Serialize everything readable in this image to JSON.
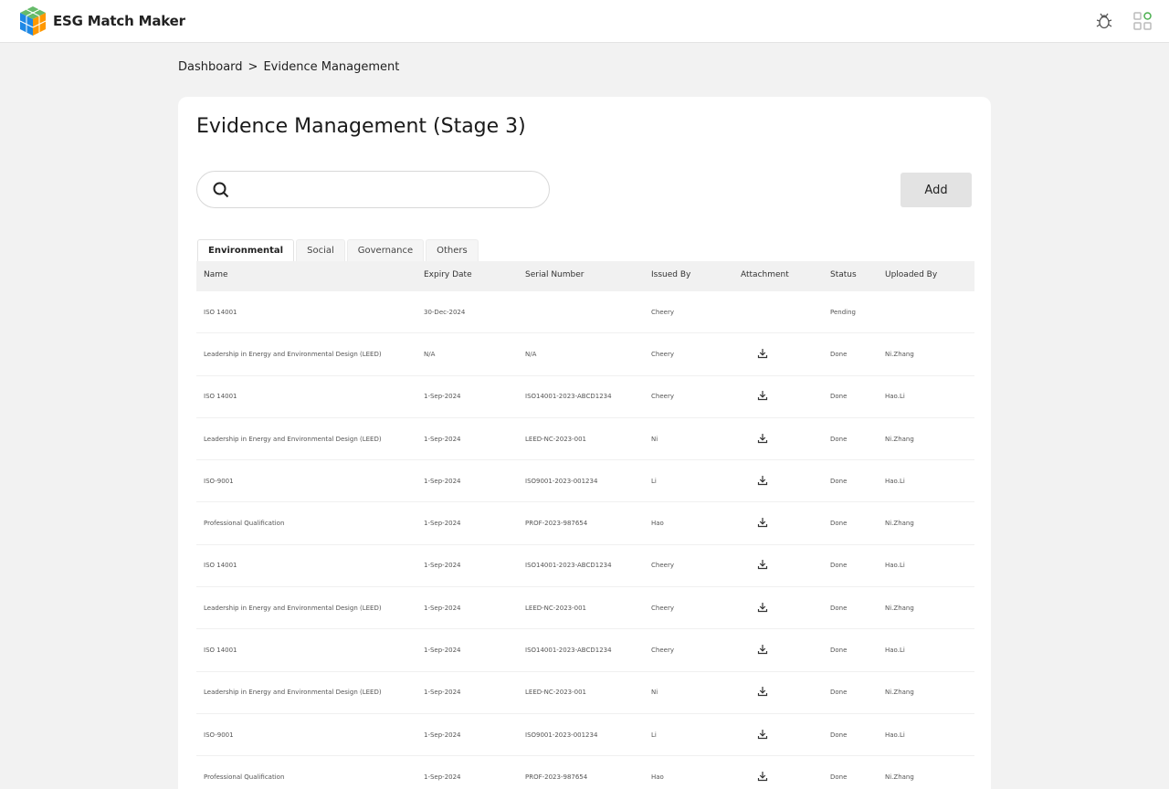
{
  "app": {
    "name": "ESG Match Maker",
    "logo_colors": [
      "#4caf50",
      "#2196f3",
      "#ff9800",
      "#1e88e5"
    ]
  },
  "topbar": {
    "icons": [
      "bug-icon",
      "apps-grid-icon"
    ]
  },
  "breadcrumb": {
    "items": [
      "Dashboard",
      "Evidence Management"
    ],
    "separator": ">"
  },
  "page": {
    "title": "Evidence Management (Stage 3)"
  },
  "search": {
    "value": "",
    "placeholder": ""
  },
  "toolbar": {
    "add_label": "Add"
  },
  "tabs": [
    {
      "label": "Environmental",
      "active": true
    },
    {
      "label": "Social",
      "active": false
    },
    {
      "label": "Governance",
      "active": false
    },
    {
      "label": "Others",
      "active": false
    }
  ],
  "table": {
    "columns": [
      "Name",
      "Expiry Date",
      "Serial Number",
      "Issued By",
      "Attachment",
      "Status",
      "Uploaded By"
    ],
    "rows": [
      {
        "name": "ISO 14001",
        "expiry": "30-Dec-2024",
        "serial": "",
        "issued_by": "Cheery",
        "attachment": false,
        "status": "Pending",
        "uploaded_by": ""
      },
      {
        "name": "Leadership in Energy and Environmental Design (LEED)",
        "expiry": "N/A",
        "serial": "N/A",
        "issued_by": "Cheery",
        "attachment": true,
        "status": "Done",
        "uploaded_by": "Ni.Zhang"
      },
      {
        "name": "ISO 14001",
        "expiry": "1-Sep-2024",
        "serial": "ISO14001-2023-ABCD1234",
        "issued_by": "Cheery",
        "attachment": true,
        "status": "Done",
        "uploaded_by": "Hao.Li"
      },
      {
        "name": "Leadership in Energy and Environmental Design (LEED)",
        "expiry": "1-Sep-2024",
        "serial": "LEED-NC-2023-001",
        "issued_by": "Ni",
        "attachment": true,
        "status": "Done",
        "uploaded_by": "Ni.Zhang"
      },
      {
        "name": "ISO-9001",
        "expiry": "1-Sep-2024",
        "serial": "ISO9001-2023-001234",
        "issued_by": "Li",
        "attachment": true,
        "status": "Done",
        "uploaded_by": "Hao.Li"
      },
      {
        "name": "Professional Qualification",
        "expiry": "1-Sep-2024",
        "serial": "PROF-2023-987654",
        "issued_by": "Hao",
        "attachment": true,
        "status": "Done",
        "uploaded_by": "Ni.Zhang"
      },
      {
        "name": "ISO 14001",
        "expiry": "1-Sep-2024",
        "serial": "ISO14001-2023-ABCD1234",
        "issued_by": "Cheery",
        "attachment": true,
        "status": "Done",
        "uploaded_by": "Hao.Li"
      },
      {
        "name": "Leadership in Energy and Environmental Design (LEED)",
        "expiry": "1-Sep-2024",
        "serial": "LEED-NC-2023-001",
        "issued_by": "Cheery",
        "attachment": true,
        "status": "Done",
        "uploaded_by": "Ni.Zhang"
      },
      {
        "name": "ISO 14001",
        "expiry": "1-Sep-2024",
        "serial": "ISO14001-2023-ABCD1234",
        "issued_by": "Cheery",
        "attachment": true,
        "status": "Done",
        "uploaded_by": "Hao.Li"
      },
      {
        "name": "Leadership in Energy and Environmental Design (LEED)",
        "expiry": "1-Sep-2024",
        "serial": "LEED-NC-2023-001",
        "issued_by": "Ni",
        "attachment": true,
        "status": "Done",
        "uploaded_by": "Ni.Zhang"
      },
      {
        "name": "ISO-9001",
        "expiry": "1-Sep-2024",
        "serial": "ISO9001-2023-001234",
        "issued_by": "Li",
        "attachment": true,
        "status": "Done",
        "uploaded_by": "Hao.Li"
      },
      {
        "name": "Professional Qualification",
        "expiry": "1-Sep-2024",
        "serial": "PROF-2023-987654",
        "issued_by": "Hao",
        "attachment": true,
        "status": "Done",
        "uploaded_by": "Ni.Zhang"
      }
    ]
  }
}
